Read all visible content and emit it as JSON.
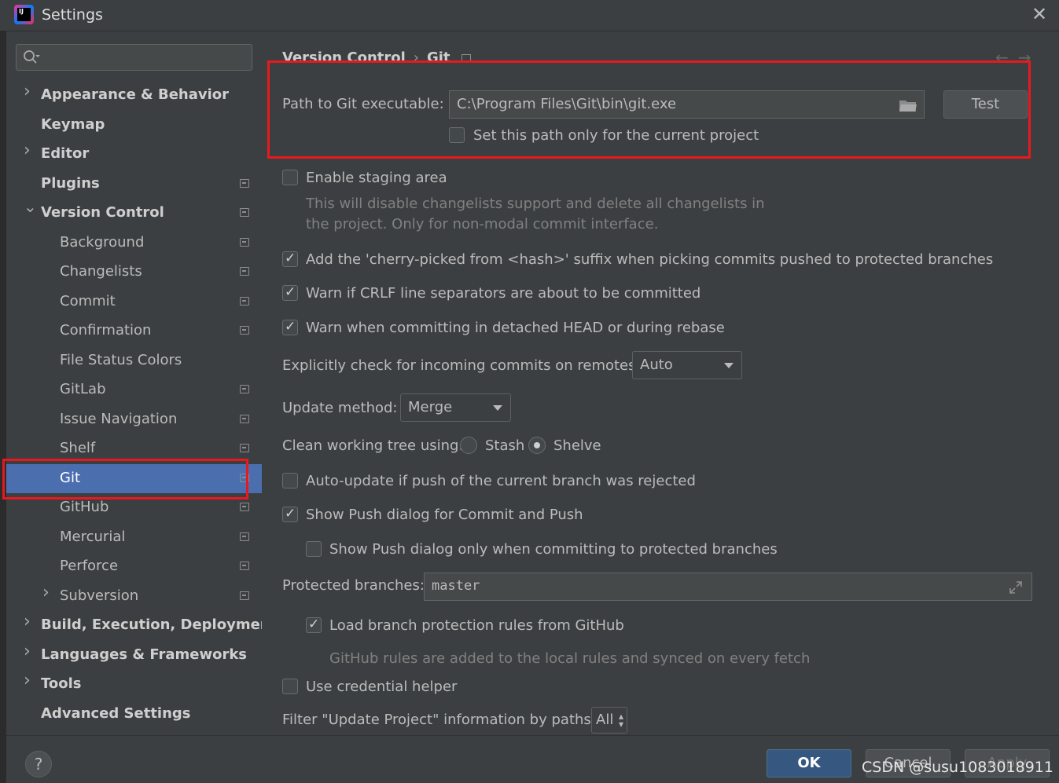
{
  "window": {
    "title": "Settings",
    "close_symbol": "✕",
    "app_logo_text": "IJ"
  },
  "sidebar": {
    "search": {
      "placeholder": ""
    },
    "items": [
      {
        "label": "Appearance & Behavior",
        "level": 0,
        "bold": true,
        "expandable": true,
        "expanded": false,
        "project_level": false
      },
      {
        "label": "Keymap",
        "level": 0,
        "bold": true,
        "expandable": false,
        "project_level": false
      },
      {
        "label": "Editor",
        "level": 0,
        "bold": true,
        "expandable": true,
        "expanded": false,
        "project_level": false
      },
      {
        "label": "Plugins",
        "level": 0,
        "bold": true,
        "expandable": false,
        "project_level": true
      },
      {
        "label": "Version Control",
        "level": 0,
        "bold": true,
        "expandable": true,
        "expanded": true,
        "project_level": true
      },
      {
        "label": "Background",
        "level": 1,
        "project_level": true
      },
      {
        "label": "Changelists",
        "level": 1,
        "project_level": true
      },
      {
        "label": "Commit",
        "level": 1,
        "project_level": true
      },
      {
        "label": "Confirmation",
        "level": 1,
        "project_level": true
      },
      {
        "label": "File Status Colors",
        "level": 1,
        "project_level": false
      },
      {
        "label": "GitLab",
        "level": 1,
        "project_level": true
      },
      {
        "label": "Issue Navigation",
        "level": 1,
        "project_level": true
      },
      {
        "label": "Shelf",
        "level": 1,
        "project_level": true
      },
      {
        "label": "Git",
        "level": 1,
        "project_level": true,
        "selected": true
      },
      {
        "label": "GitHub",
        "level": 1,
        "project_level": true
      },
      {
        "label": "Mercurial",
        "level": 1,
        "project_level": true
      },
      {
        "label": "Perforce",
        "level": 1,
        "project_level": true
      },
      {
        "label": "Subversion",
        "level": 1,
        "expandable": true,
        "project_level": true
      },
      {
        "label": "Build, Execution, Deployment",
        "level": 0,
        "bold": true,
        "expandable": true
      },
      {
        "label": "Languages & Frameworks",
        "level": 0,
        "bold": true,
        "expandable": true
      },
      {
        "label": "Tools",
        "level": 0,
        "bold": true,
        "expandable": true
      },
      {
        "label": "Advanced Settings",
        "level": 0,
        "bold": true,
        "expandable": false
      }
    ]
  },
  "breadcrumb": {
    "parent": "Version Control",
    "separator": "›",
    "current": "Git"
  },
  "git_path": {
    "label": "Path to Git executable:",
    "value": "C:\\Program Files\\Git\\bin\\git.exe",
    "test_button": "Test",
    "current_project_only": {
      "label": "Set this path only for the current project",
      "checked": false
    }
  },
  "staging": {
    "label": "Enable staging area",
    "checked": false,
    "hint_line1": "This will disable changelists support and delete all changelists in",
    "hint_line2": "the project. Only for non-modal commit interface."
  },
  "cherry_pick": {
    "label": "Add the 'cherry-picked from <hash>' suffix when picking commits pushed to protected branches",
    "checked": true
  },
  "crlf": {
    "label": "Warn if CRLF line separators are about to be committed",
    "checked": true
  },
  "detached": {
    "label": "Warn when committing in detached HEAD or during rebase",
    "checked": true
  },
  "incoming": {
    "label": "Explicitly check for incoming commits on remotes:",
    "value": "Auto"
  },
  "update_method": {
    "label": "Update method:",
    "value": "Merge"
  },
  "clean_tree": {
    "label": "Clean working tree using:",
    "option1": "Stash",
    "option2": "Shelve",
    "selected": "Shelve"
  },
  "auto_update": {
    "label": "Auto-update if push of the current branch was rejected",
    "checked": false
  },
  "show_push": {
    "label": "Show Push dialog for Commit and Push",
    "checked": true
  },
  "show_push_protected": {
    "label": "Show Push dialog only when committing to protected branches",
    "checked": false
  },
  "protected": {
    "label": "Protected branches:",
    "value": "master"
  },
  "load_protection": {
    "label": "Load branch protection rules from GitHub",
    "checked": true,
    "hint": "GitHub rules are added to the local rules and synced on every fetch"
  },
  "credential": {
    "label": "Use credential helper",
    "checked": false
  },
  "filter": {
    "label": "Filter \"Update Project\" information by paths:",
    "value": "All"
  },
  "footer": {
    "help": "?",
    "ok": "OK",
    "cancel": "Cancel",
    "apply": "Apply"
  },
  "watermark": "CSDN @susu1083018911",
  "colors": {
    "selection": "#4b6eaf",
    "highlight_box": "#e8191e",
    "background": "#3c3f41"
  }
}
